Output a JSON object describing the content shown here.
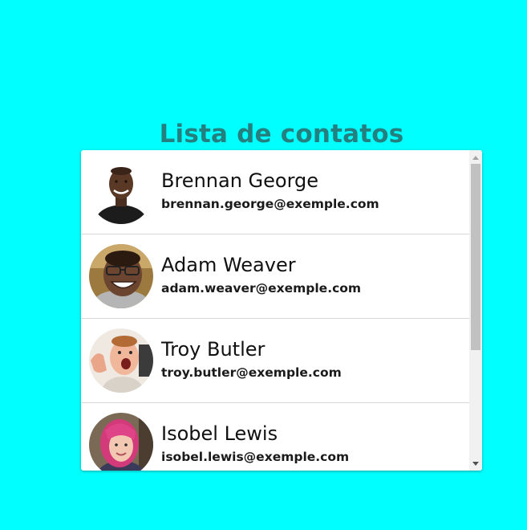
{
  "page": {
    "title": "Lista de contatos",
    "background_color": "#00ffff",
    "title_color": "#257f7f"
  },
  "contacts": [
    {
      "name": "Brennan George",
      "email": "brennan.george@exemple.com",
      "avatar_icon": "person-photo-avatar"
    },
    {
      "name": "Adam Weaver",
      "email": "adam.weaver@exemple.com",
      "avatar_icon": "person-photo-avatar"
    },
    {
      "name": "Troy Butler",
      "email": "troy.butler@exemple.com",
      "avatar_icon": "person-photo-avatar"
    },
    {
      "name": "Isobel Lewis",
      "email": "isobel.lewis@exemple.com",
      "avatar_icon": "person-photo-avatar"
    }
  ],
  "scrollbar": {
    "up_icon": "scroll-up-arrow-icon",
    "down_icon": "scroll-down-arrow-icon"
  }
}
